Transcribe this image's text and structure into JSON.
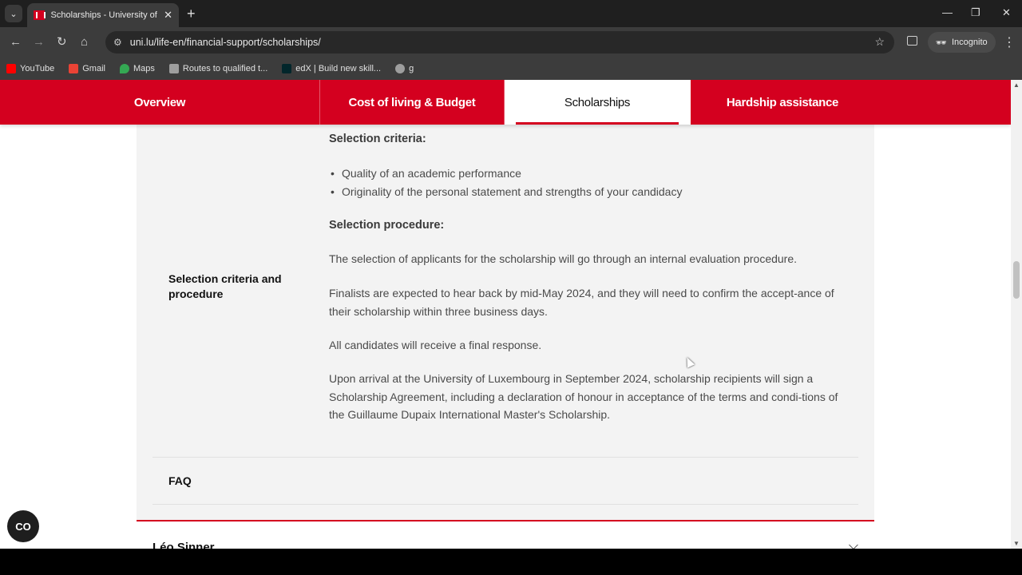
{
  "browser": {
    "tab_title": "Scholarships - University of Luxembourg",
    "tab_close": "✕",
    "new_tab": "+",
    "url": "uni.lu/life-en/financial-support/scholarships/",
    "incognito_label": "Incognito",
    "window_controls": [
      "—",
      "❐",
      "✕"
    ],
    "bookmarks": [
      {
        "label": "YouTube",
        "icon": "youtube-icon",
        "color": "#ff0000"
      },
      {
        "label": "Gmail",
        "icon": "gmail-icon",
        "color": "#ea4335"
      },
      {
        "label": "Maps",
        "icon": "maps-icon",
        "color": "#34a853"
      },
      {
        "label": "Routes to qualified t...",
        "icon": "routes-icon",
        "color": "#9e9e9e"
      },
      {
        "label": "edX | Build new skill...",
        "icon": "edx-icon",
        "color": "#02262b"
      },
      {
        "label": "g",
        "icon": "globe-icon",
        "color": "#9e9e9e"
      }
    ]
  },
  "subnav": {
    "items": [
      {
        "label": "Overview",
        "active": false
      },
      {
        "label": "Cost of living & Budget",
        "active": false
      },
      {
        "label": "Scholarships",
        "active": true
      },
      {
        "label": "Hardship assistance",
        "active": false
      }
    ]
  },
  "section": {
    "row_label": "Selection criteria and procedure",
    "criteria_heading": "Selection criteria:",
    "criteria_items": [
      "Quality of an academic performance",
      "Originality of the personal statement and strengths of your candidacy"
    ],
    "procedure_heading": "Selection procedure:",
    "paragraphs": [
      "The selection of applicants for the scholarship will go through an internal evaluation procedure.",
      "Finalists are expected to hear back by mid-May 2024, and they will need to confirm the accept-ance of their scholarship within three business days.",
      "All candidates will receive a final response.",
      "Upon arrival at the University of Luxembourg in September 2024, scholarship recipients will sign a Scholarship Agreement, including a declaration of honour in acceptance of the terms and condi-tions of the Guillaume Dupaix International Master's Scholarship."
    ]
  },
  "faq_label": "FAQ",
  "next_section_title": "Léo Sinner",
  "fab_label": "CO"
}
